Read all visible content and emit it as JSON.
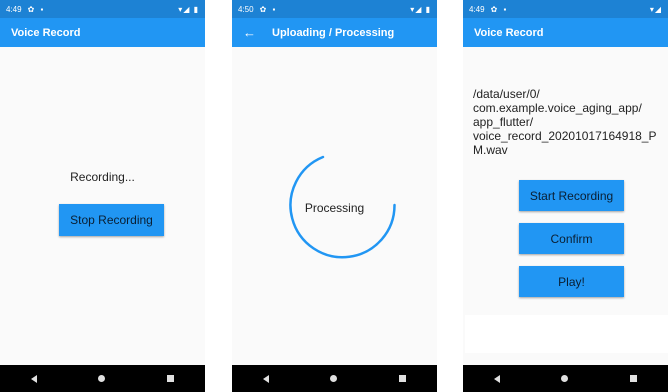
{
  "screen1": {
    "status_time": "4:49",
    "title": "Voice Record",
    "status_text": "Recording...",
    "stop_label": "Stop Recording"
  },
  "screen2": {
    "status_time": "4:50",
    "title": "Uploading / Processing",
    "processing_label": "Processing"
  },
  "screen3": {
    "status_time": "4:49",
    "title": "Voice Record",
    "file_path": "/data/user/0/\ncom.example.voice_aging_app/\napp_flutter/\nvoice_record_20201017164918_PM.wav",
    "start_label": "Start Recording",
    "confirm_label": "Confirm",
    "play_label": "Play!"
  },
  "icons": [
    "settings-icon",
    "sim-icon",
    "wifi-icon",
    "signal-icon",
    "battery-icon",
    "back-arrow-icon",
    "nav-back-icon",
    "nav-home-icon",
    "nav-recents-icon"
  ],
  "colors": {
    "appbar": "#2196f3",
    "statusbar": "#1d82d4",
    "button": "#2196f3",
    "spinner": "#2196f3"
  }
}
